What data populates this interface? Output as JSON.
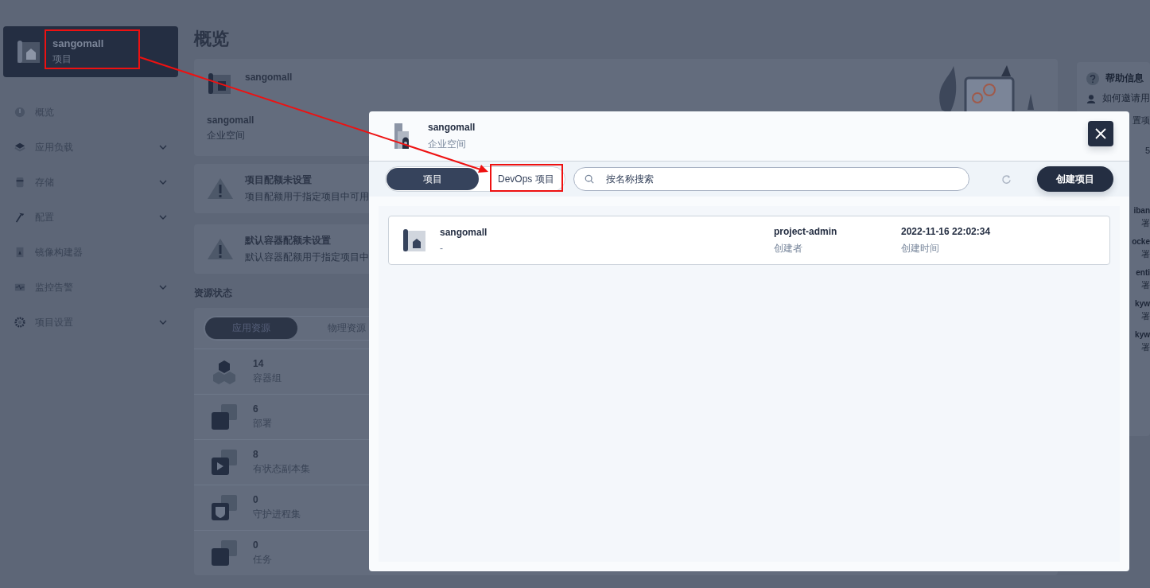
{
  "sidebar": {
    "project": {
      "name": "sangomall",
      "type": "项目"
    },
    "items": [
      {
        "label": "概览",
        "expandable": false
      },
      {
        "label": "应用负载",
        "expandable": true
      },
      {
        "label": "存储",
        "expandable": true
      },
      {
        "label": "配置",
        "expandable": true
      },
      {
        "label": "镜像构建器",
        "expandable": false
      },
      {
        "label": "监控告警",
        "expandable": true
      },
      {
        "label": "项目设置",
        "expandable": true
      }
    ]
  },
  "page": {
    "title": "概览",
    "project_card": {
      "name": "sangomall",
      "workspace": "sangomall",
      "workspace_label": "企业空间"
    },
    "warnings": [
      {
        "title": "项目配额未设置",
        "text": "项目配额用于指定项目中可用"
      },
      {
        "title": "默认容器配额未设置",
        "text": "默认容器配额用于指定项目中"
      }
    ],
    "resource_title": "资源状态",
    "resource_tabs": [
      {
        "label": "应用资源",
        "selected": true
      },
      {
        "label": "物理资源",
        "selected": false
      }
    ],
    "resources": [
      {
        "count": "14",
        "label": "容器组"
      },
      {
        "count": "6",
        "label": "部署"
      },
      {
        "count": "8",
        "label": "有状态副本集"
      },
      {
        "count": "0",
        "label": "守护进程集"
      },
      {
        "count": "0",
        "label": "任务"
      }
    ]
  },
  "help_panel": {
    "title": "帮助信息",
    "link": "如何邀请用",
    "text": "置项",
    "count": "5",
    "apps": [
      {
        "name": "iban",
        "type": "署"
      },
      {
        "name": "ocke",
        "type": "署"
      },
      {
        "name": "enti",
        "type": "署"
      },
      {
        "name": "kyw",
        "type": "署"
      },
      {
        "name": "kyw",
        "type": "署"
      }
    ]
  },
  "dialog": {
    "workspace": {
      "name": "sangomall",
      "label": "企业空间"
    },
    "tabs": [
      {
        "label": "项目",
        "selected": true
      },
      {
        "label": "DevOps 项目",
        "selected": false
      }
    ],
    "search": {
      "placeholder": "按名称搜索"
    },
    "create_button": "创建项目",
    "projects": [
      {
        "name": "sangomall",
        "description": "-",
        "creator": "project-admin",
        "creator_label": "创建者",
        "created": "2022-11-16 22:02:34",
        "created_label": "创建时间"
      }
    ]
  }
}
